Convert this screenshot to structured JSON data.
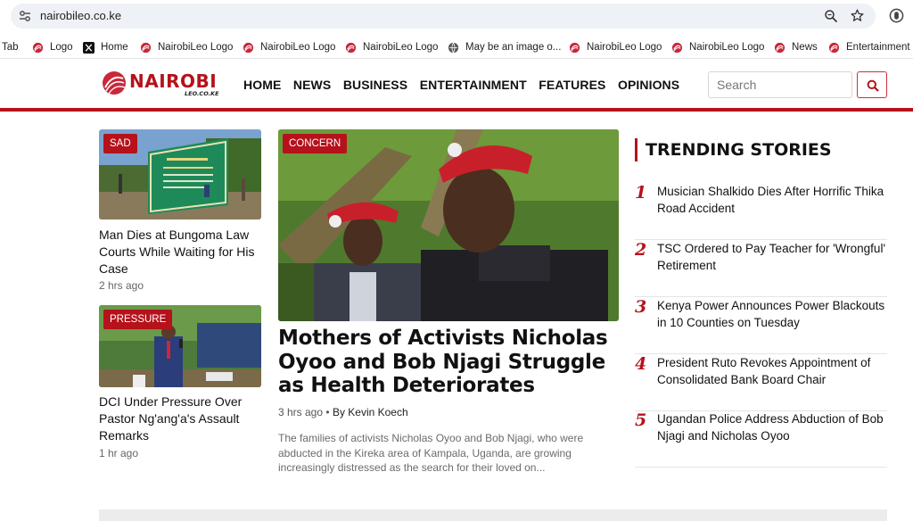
{
  "browser": {
    "url": "nairobileo.co.ke",
    "bookmarks": [
      {
        "label": "Tab",
        "icon": "none"
      },
      {
        "label": "Logo",
        "icon": "nairobileo-favicon"
      },
      {
        "label": "Home",
        "icon": "x-icon"
      },
      {
        "label": "NairobiLeo Logo",
        "icon": "nairobileo-favicon"
      },
      {
        "label": "NairobiLeo Logo",
        "icon": "nairobileo-favicon"
      },
      {
        "label": "NairobiLeo Logo",
        "icon": "nairobileo-favicon"
      },
      {
        "label": "May be an image o...",
        "icon": "globe-icon"
      },
      {
        "label": "NairobiLeo Logo",
        "icon": "nairobileo-favicon"
      },
      {
        "label": "NairobiLeo Logo",
        "icon": "nairobileo-favicon"
      },
      {
        "label": "News",
        "icon": "nairobileo-favicon"
      },
      {
        "label": "Entertainment",
        "icon": "nairobileo-favicon"
      }
    ]
  },
  "site": {
    "logo_word": "NAIROBI",
    "logo_sub": "LEO.CO.KE",
    "nav": [
      "HOME",
      "NEWS",
      "BUSINESS",
      "ENTERTAINMENT",
      "FEATURES",
      "OPINIONS"
    ],
    "search_placeholder": "Search",
    "accent": "#b5121b"
  },
  "left_stories": [
    {
      "tag": "SAD",
      "title": "Man Dies at Bungoma Law Courts While Waiting for His Case",
      "time": "2 hrs ago"
    },
    {
      "tag": "PRESSURE",
      "title": "DCI Under Pressure Over Pastor Ng'ang'a's Assault Remarks",
      "time": "1 hr ago"
    }
  ],
  "feature": {
    "tag": "CONCERN",
    "title": "Mothers of Activists Nicholas Oyoo and Bob Njagi Struggle as Health Deteriorates",
    "time": "3 hrs ago",
    "separator": "•",
    "byline": "By Kevin Koech",
    "excerpt": "The families of activists Nicholas Oyoo and Bob Njagi, who were abducted in the Kireka area of Kampala, Uganda, are growing increasingly distressed as the search for their loved on..."
  },
  "trending": {
    "heading": "TRENDING STORIES",
    "items": [
      {
        "num": "1",
        "title": "Musician Shalkido Dies After Horrific Thika Road Accident"
      },
      {
        "num": "2",
        "title": "TSC Ordered to Pay Teacher for 'Wrongful' Retirement"
      },
      {
        "num": "3",
        "title": "Kenya Power Announces Power Blackouts in 10 Counties on Tuesday"
      },
      {
        "num": "4",
        "title": "President Ruto Revokes Appointment of Consolidated Bank Board Chair"
      },
      {
        "num": "5",
        "title": "Ugandan Police Address Abduction of Bob Njagi and Nicholas Oyoo"
      }
    ]
  }
}
